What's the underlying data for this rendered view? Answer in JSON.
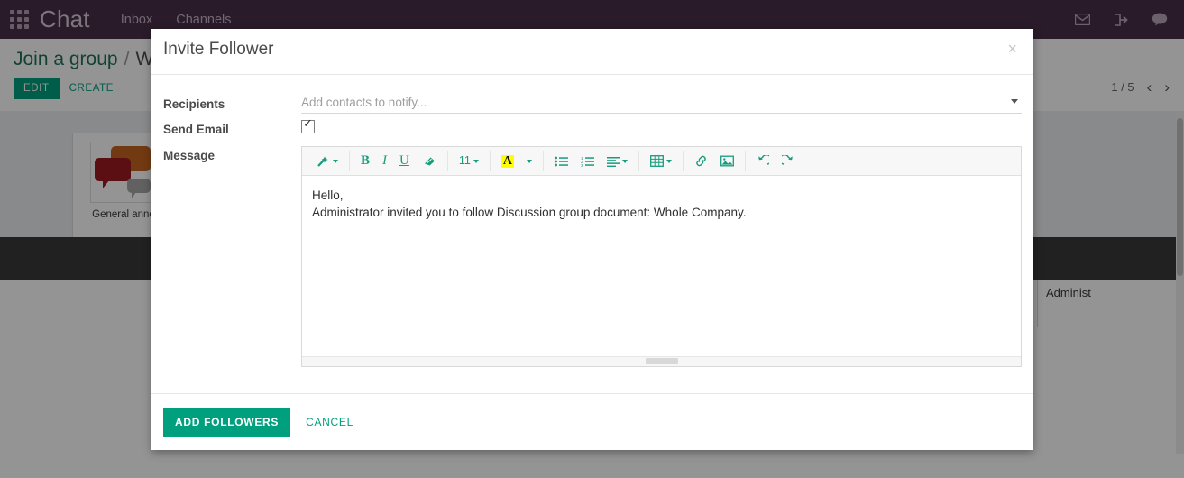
{
  "topbar": {
    "apps_icon": "apps-grid-icon",
    "brand": "Chat",
    "menu": [
      {
        "label": "Inbox"
      },
      {
        "label": "Channels"
      }
    ],
    "icons": [
      {
        "name": "mail-icon"
      },
      {
        "name": "sign-in-icon"
      },
      {
        "name": "chat-bubble-icon"
      }
    ]
  },
  "background": {
    "breadcrumb": {
      "root": "Join a group",
      "separator": "/",
      "current": "Who"
    },
    "buttons": {
      "edit": "EDIT",
      "create": "CREATE"
    },
    "pager": {
      "counter": "1 / 5",
      "prev": "‹",
      "next": "›"
    },
    "kanban_card": {
      "caption": "General anno",
      "image_name": "speech-bubbles-image"
    },
    "admin_text": "Administ"
  },
  "modal": {
    "title": "Invite Follower",
    "close_label": "×",
    "fields": {
      "recipients_label": "Recipients",
      "recipients_placeholder": "Add contacts to notify...",
      "recipients_value": "",
      "send_email_label": "Send Email",
      "send_email_checked": true,
      "message_label": "Message"
    },
    "editor": {
      "toolbar": [
        {
          "name": "style-magic-wand-icon",
          "label": "",
          "has_caret": true
        },
        {
          "name": "bold-button",
          "label": "B",
          "has_caret": false
        },
        {
          "name": "italic-button",
          "label": "I",
          "has_caret": false
        },
        {
          "name": "underline-button",
          "label": "U",
          "has_caret": false
        },
        {
          "name": "clear-format-eraser-icon",
          "label": "",
          "has_caret": false
        },
        {
          "name": "font-size-select",
          "label": "11",
          "has_caret": true
        },
        {
          "name": "text-highlight-color-button",
          "label": "A",
          "has_caret": true
        },
        {
          "name": "unordered-list-button",
          "label": "",
          "has_caret": false
        },
        {
          "name": "ordered-list-button",
          "label": "",
          "has_caret": false
        },
        {
          "name": "paragraph-align-button",
          "label": "",
          "has_caret": true
        },
        {
          "name": "table-insert-button",
          "label": "",
          "has_caret": true
        },
        {
          "name": "insert-link-button",
          "label": "",
          "has_caret": false
        },
        {
          "name": "insert-image-button",
          "label": "",
          "has_caret": false
        },
        {
          "name": "undo-button",
          "label": "",
          "has_caret": false
        },
        {
          "name": "redo-button",
          "label": "",
          "has_caret": false
        }
      ],
      "font_size_value": "11",
      "body_line1": "Hello,",
      "body_line2": "Administrator invited you to follow Discussion group document: Whole Company."
    },
    "footer": {
      "submit_label": "ADD FOLLOWERS",
      "cancel_label": "CANCEL"
    }
  },
  "colors": {
    "topbar_bg": "#49304b",
    "accent_green": "#00a07f",
    "editor_green": "#179c7d",
    "highlight_yellow": "#ffff00"
  }
}
